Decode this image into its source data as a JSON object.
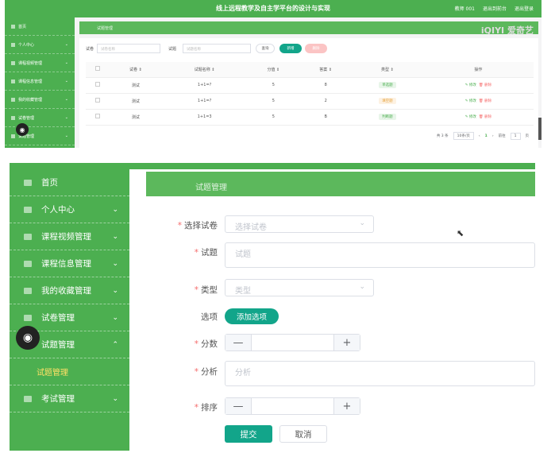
{
  "top_panel": {
    "header": {
      "title": "线上远程教学及自主学平台的设计与实现",
      "links": [
        "教师 001",
        "退出到前台",
        "退出登录"
      ]
    },
    "sidebar": {
      "items": [
        {
          "label": "首页",
          "icon": "home-icon",
          "chevron": ""
        },
        {
          "label": "个人中心",
          "icon": "user-icon",
          "chevron": "⌄"
        },
        {
          "label": "课程视频管理",
          "icon": "video-icon",
          "chevron": "⌄"
        },
        {
          "label": "课程信息管理",
          "icon": "book-icon",
          "chevron": "⌄"
        },
        {
          "label": "我的收藏管理",
          "icon": "star-icon",
          "chevron": "⌄"
        },
        {
          "label": "试卷管理",
          "icon": "paper-icon",
          "chevron": "⌄"
        },
        {
          "label": "试题管理",
          "icon": "question-icon",
          "chevron": "⌄"
        }
      ]
    },
    "breadcrumb": "试题管理",
    "watermark": "爱奇艺",
    "watermark_logo": "iQIYI",
    "filters": {
      "paper_label": "试卷",
      "paper_placeholder": "试卷名称",
      "question_label": "试题",
      "question_placeholder": "试题名称",
      "search_label": "查询",
      "add_label": "新增",
      "delete_label": "删除"
    },
    "table": {
      "headers": [
        "试卷 ⇕",
        "试题名称 ⇕",
        "分值 ⇕",
        "答案 ⇕",
        "类型 ⇕",
        "操作"
      ],
      "rows": [
        {
          "paper": "测试",
          "name": "1+1=?",
          "score": "5",
          "answer": "8",
          "type": "单选题",
          "type_color": "#e8f5e9",
          "type_text": "#4caf50"
        },
        {
          "paper": "测试",
          "name": "1+1=?",
          "score": "5",
          "answer": "2",
          "type": "填空题",
          "type_color": "#fdf2e3",
          "type_text": "#e6a23c"
        },
        {
          "paper": "测试",
          "name": "1+1=3",
          "score": "5",
          "answer": "B",
          "type": "判断题",
          "type_color": "#e8f5e9",
          "type_text": "#4caf50"
        }
      ],
      "edit_label": "✎ 修改",
      "delete_label": "🗑 删除"
    },
    "pagination": {
      "total": "共 3 条",
      "page_size": "10条/页",
      "prev": "‹",
      "current": "1",
      "next": "›",
      "goto_label": "前往",
      "goto_value": "1",
      "page_unit": "页"
    }
  },
  "bottom_panel": {
    "sidebar": {
      "items": [
        {
          "label": "首页",
          "chevron": ""
        },
        {
          "label": "个人中心",
          "chevron": "⌄"
        },
        {
          "label": "课程视频管理",
          "chevron": "⌄"
        },
        {
          "label": "课程信息管理",
          "chevron": "⌄"
        },
        {
          "label": "我的收藏管理",
          "chevron": "⌄"
        },
        {
          "label": "试卷管理",
          "chevron": "⌄"
        },
        {
          "label": "试题管理",
          "chevron": "⌃"
        }
      ],
      "sub_item": "试题管理",
      "last_item": {
        "label": "考试管理",
        "chevron": "⌄"
      }
    },
    "breadcrumb": "试题管理",
    "form": {
      "paper_label": "选择试卷",
      "paper_placeholder": "选择试卷",
      "question_label": "试题",
      "question_placeholder": "试题",
      "type_label": "类型",
      "type_placeholder": "类型",
      "options_label": "选项",
      "add_option_label": "添加选项",
      "score_label": "分数",
      "analysis_label": "分析",
      "analysis_placeholder": "分析",
      "order_label": "排序",
      "submit_label": "提交",
      "cancel_label": "取消",
      "required_mark": "*",
      "minus": "—",
      "plus": "+"
    }
  }
}
